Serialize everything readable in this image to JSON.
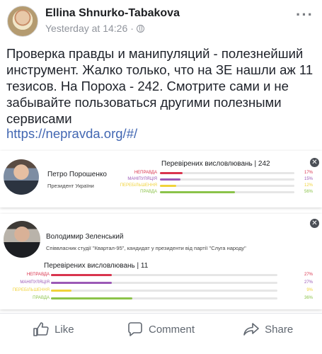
{
  "post": {
    "author": "Ellina Shnurko-Tabakova",
    "timestamp": "Yesterday at 14:26",
    "separator": "·",
    "text": "Проверка правды и манипуляций - полезнейший инструмент. Жалко только, что на ЗЕ нашли аж 11 тезисов. На Пороха - 242. Смотрите сами и не забывайте пользоваться другими полезными сервисами",
    "link": "https://nepravda.org/#/",
    "more_icon": "more-dots-icon",
    "privacy_icon": "globe-icon"
  },
  "cards": [
    {
      "name": "Петро Порошенко",
      "role": "Президент України",
      "stats_title": "Перевірених висловлювань | 242",
      "bars": [
        {
          "label": "НЕПРАВДА",
          "percent": "17%",
          "value": 17,
          "color": "#d9344e"
        },
        {
          "label": "МАНІПУЛЯЦІЯ",
          "percent": "15%",
          "value": 15,
          "color": "#9b59b6"
        },
        {
          "label": "ПЕРЕБІЛЬШЕННЯ",
          "percent": "12%",
          "value": 12,
          "color": "#f0d33a"
        },
        {
          "label": "ПРАВДА",
          "percent": "56%",
          "value": 56,
          "color": "#8bc34a"
        }
      ]
    },
    {
      "name": "Володимир Зеленський",
      "role": "Співвласник студії \"Квартал-95\", кандидат у президенти від партії \"Слуга народу\"",
      "stats_title": "Перевірених висловлювань | 11",
      "bars": [
        {
          "label": "НЕПРАВДА",
          "percent": "27%",
          "value": 27,
          "color": "#d9344e"
        },
        {
          "label": "МАНІПУЛЯЦІЯ",
          "percent": "27%",
          "value": 27,
          "color": "#9b59b6"
        },
        {
          "label": "ПЕРЕБІЛЬШЕННЯ",
          "percent": "9%",
          "value": 9,
          "color": "#f0d33a"
        },
        {
          "label": "ПРАВДА",
          "percent": "36%",
          "value": 36,
          "color": "#8bc34a"
        }
      ]
    }
  ],
  "actions": {
    "like": "Like",
    "comment": "Comment",
    "share": "Share"
  },
  "colors": {
    "link": "#4267b2",
    "meta": "#90949c",
    "action": "#606770"
  }
}
